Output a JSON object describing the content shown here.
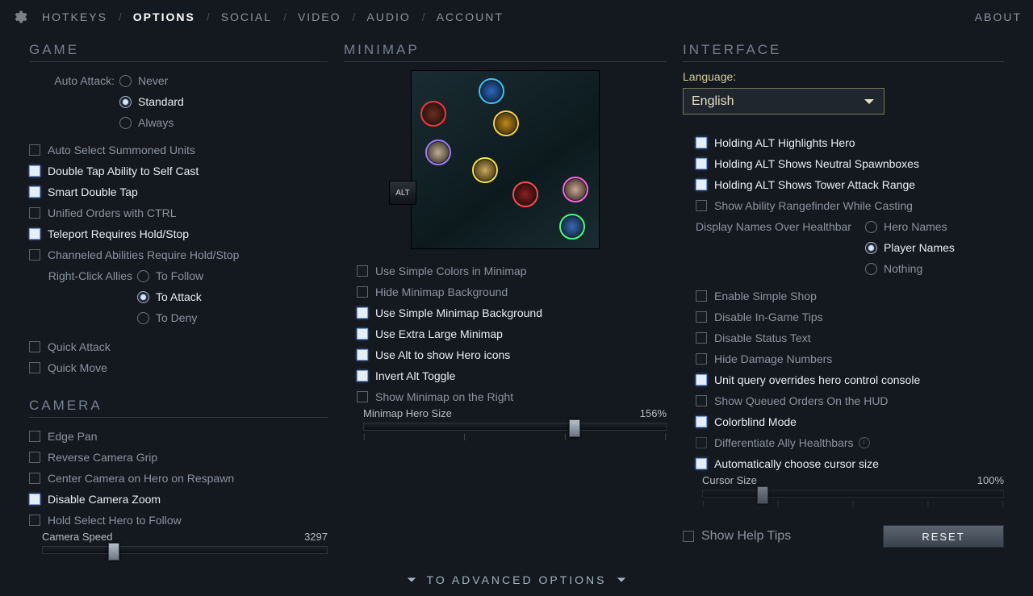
{
  "nav": {
    "items": [
      "HOTKEYS",
      "OPTIONS",
      "SOCIAL",
      "VIDEO",
      "AUDIO",
      "ACCOUNT"
    ],
    "active_index": 1,
    "about": "ABOUT"
  },
  "game": {
    "heading": "GAME",
    "auto_attack_label": "Auto Attack:",
    "auto_attack_options": [
      "Never",
      "Standard",
      "Always"
    ],
    "auto_attack_sel": 1,
    "checks": [
      {
        "label": "Auto Select Summoned Units",
        "on": false
      },
      {
        "label": "Double Tap Ability to Self Cast",
        "on": true
      },
      {
        "label": "Smart Double Tap",
        "on": true
      },
      {
        "label": "Unified Orders with CTRL",
        "on": false
      },
      {
        "label": "Teleport Requires Hold/Stop",
        "on": true
      },
      {
        "label": "Channeled Abilities Require Hold/Stop",
        "on": false
      }
    ],
    "rc_label": "Right-Click Allies",
    "rc_options": [
      "To Follow",
      "To Attack",
      "To Deny"
    ],
    "rc_sel": 1,
    "checks2": [
      {
        "label": "Quick Attack",
        "on": false
      },
      {
        "label": "Quick Move",
        "on": false
      }
    ]
  },
  "camera": {
    "heading": "CAMERA",
    "checks": [
      {
        "label": "Edge Pan",
        "on": false
      },
      {
        "label": "Reverse Camera Grip",
        "on": false
      },
      {
        "label": "Center Camera on Hero on Respawn",
        "on": false
      },
      {
        "label": "Disable Camera Zoom",
        "on": true
      },
      {
        "label": "Hold Select Hero to Follow",
        "on": false
      }
    ],
    "speed_label": "Camera Speed",
    "speed_value": "3297",
    "speed_pct": 23
  },
  "minimap": {
    "heading": "MINIMAP",
    "alt_key": "ALT",
    "checks": [
      {
        "label": "Use Simple Colors in Minimap",
        "on": false
      },
      {
        "label": "Hide Minimap Background",
        "on": false
      },
      {
        "label": "Use Simple Minimap Background",
        "on": true
      },
      {
        "label": "Use Extra Large Minimap",
        "on": true
      },
      {
        "label": "Use Alt to show Hero icons",
        "on": true
      },
      {
        "label": "Invert Alt Toggle",
        "on": true
      },
      {
        "label": "Show Minimap on the Right",
        "on": false
      }
    ],
    "hero_size_label": "Minimap Hero Size",
    "hero_size_value": "156%",
    "hero_size_pct": 68
  },
  "interface": {
    "heading": "INTERFACE",
    "lang_label": "Language:",
    "lang_value": "English",
    "alt_checks": [
      {
        "label": "Holding ALT Highlights Hero",
        "on": true
      },
      {
        "label": "Holding ALT Shows Neutral Spawnboxes",
        "on": true
      },
      {
        "label": "Holding ALT Shows Tower Attack Range",
        "on": true
      },
      {
        "label": "Show Ability Rangefinder While Casting",
        "on": false
      }
    ],
    "names_label": "Display Names Over Healthbar",
    "names_options": [
      "Hero Names",
      "Player Names",
      "Nothing"
    ],
    "names_sel": 1,
    "checks": [
      {
        "label": "Enable Simple Shop",
        "on": false
      },
      {
        "label": "Disable In-Game Tips",
        "on": false
      },
      {
        "label": "Disable Status Text",
        "on": false
      },
      {
        "label": "Hide Damage Numbers",
        "on": false
      },
      {
        "label": "Unit query overrides hero control console",
        "on": true
      },
      {
        "label": "Show Queued Orders On the HUD",
        "on": false
      },
      {
        "label": "Colorblind Mode",
        "on": true
      }
    ],
    "diff_ally": "Differentiate Ally Healthbars",
    "auto_cursor": {
      "label": "Automatically choose cursor size",
      "on": true
    },
    "cursor_size_label": "Cursor Size",
    "cursor_size_value": "100%",
    "cursor_size_pct": 18,
    "help_tips": {
      "label": "Show Help Tips",
      "on": false
    },
    "reset": "RESET"
  },
  "advanced": "TO ADVANCED OPTIONS"
}
